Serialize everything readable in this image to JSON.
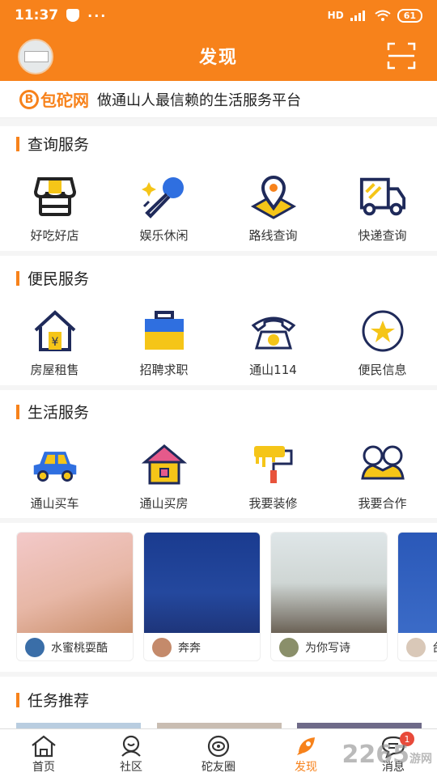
{
  "status": {
    "time": "11:37",
    "dots": "···",
    "signal": "HD",
    "battery": "61"
  },
  "header": {
    "title": "发现"
  },
  "slogan": {
    "logo_letter": "B",
    "logo_text": "包砣网",
    "text": "做通山人最信赖的生活服务平台"
  },
  "sections": [
    {
      "title": "查询服务",
      "items": [
        {
          "label": "好吃好店",
          "icon": "store-icon"
        },
        {
          "label": "娱乐休闲",
          "icon": "microphone-icon"
        },
        {
          "label": "路线查询",
          "icon": "map-pin-icon"
        },
        {
          "label": "快递查询",
          "icon": "truck-icon"
        }
      ]
    },
    {
      "title": "便民服务",
      "items": [
        {
          "label": "房屋租售",
          "icon": "house-yen-icon"
        },
        {
          "label": "招聘求职",
          "icon": "briefcase-icon"
        },
        {
          "label": "通山114",
          "icon": "telephone-icon"
        },
        {
          "label": "便民信息",
          "icon": "star-badge-icon"
        }
      ]
    },
    {
      "title": "生活服务",
      "items": [
        {
          "label": "通山买车",
          "icon": "car-icon"
        },
        {
          "label": "通山买房",
          "icon": "home-icon"
        },
        {
          "label": "我要装修",
          "icon": "paint-roller-icon"
        },
        {
          "label": "我要合作",
          "icon": "handshake-icon"
        }
      ]
    }
  ],
  "cards": [
    {
      "user": "水蜜桃耍酷"
    },
    {
      "user": "奔奔"
    },
    {
      "user": "为你写诗"
    },
    {
      "user": "台"
    }
  ],
  "tasks": {
    "title": "任务推荐"
  },
  "tabbar": [
    {
      "label": "首页",
      "icon": "home-outline-icon"
    },
    {
      "label": "社区",
      "icon": "community-icon"
    },
    {
      "label": "砣友圈",
      "icon": "circle-eye-icon"
    },
    {
      "label": "发现",
      "icon": "rocket-icon"
    },
    {
      "label": "消息",
      "icon": "message-icon",
      "badge": "1"
    }
  ],
  "watermark": {
    "text": "2265",
    "sub": "游网"
  },
  "colors": {
    "brand": "#f7821b",
    "icon_dark": "#1f2a5a",
    "icon_yellow": "#f5c518",
    "icon_blue": "#2f6fe0"
  }
}
